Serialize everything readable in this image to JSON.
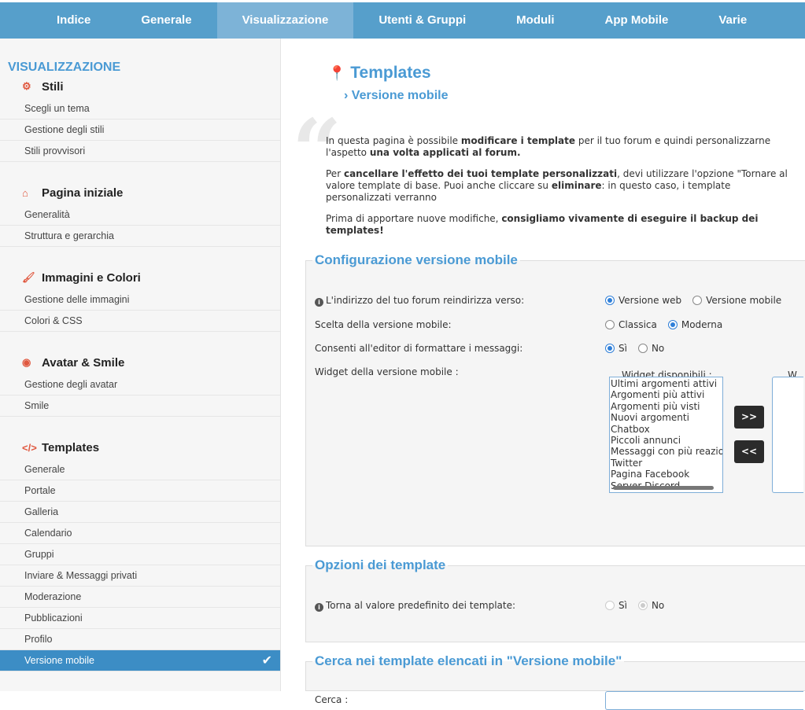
{
  "nav": [
    "Indice",
    "Generale",
    "Visualizzazione",
    "Utenti & Gruppi",
    "Moduli",
    "App Mobile",
    "Varie"
  ],
  "sidebar": {
    "heading": "VISUALIZZAZIONE",
    "sections": [
      {
        "title": "Stili",
        "icon": "gears-icon",
        "items": [
          "Scegli un tema",
          "Gestione degli stili",
          "Stili provvisori"
        ]
      },
      {
        "title": "Pagina iniziale",
        "icon": "home-icon",
        "items": [
          "Generalità",
          "Struttura e gerarchia"
        ]
      },
      {
        "title": "Immagini e Colori",
        "icon": "brush-icon",
        "items": [
          "Gestione delle immagini",
          "Colori & CSS"
        ]
      },
      {
        "title": "Avatar & Smile",
        "icon": "user-circle-icon",
        "items": [
          "Gestione degli avatar",
          "Smile"
        ]
      },
      {
        "title": "Templates",
        "icon": "code-icon",
        "items": [
          "Generale",
          "Portale",
          "Galleria",
          "Calendario",
          "Gruppi",
          "Inviare & Messaggi privati",
          "Moderazione",
          "Pubblicazioni",
          "Profilo",
          "Versione mobile"
        ]
      }
    ]
  },
  "main": {
    "title": "Templates",
    "subtitle": "Versione mobile",
    "intro": {
      "p1a": "In questa pagina è possibile ",
      "p1b": "modificare i template",
      "p1c": " per il tuo forum e quindi personalizzarne l'aspetto",
      "p1d": "una volta applicati al forum.",
      "p2a": "Per ",
      "p2b": "cancellare l'effetto dei tuoi template personalizzati",
      "p2c": ", devi utilizzare l'opzione \"Tornare al valore",
      "p2d": "template di base. Puoi anche cliccare su ",
      "p2e": "eliminare",
      "p2f": ": in questo caso, i template personalizzati verranno",
      "p3a": "Prima di apportare nuove modifiche, ",
      "p3b": "consigliamo vivamente di eseguire il backup dei templates!"
    },
    "config": {
      "legend": "Configurazione versione mobile",
      "redirect_label": "L'indirizzo del tuo forum reindirizza verso:",
      "redirect_opts": [
        "Versione web",
        "Versione mobile"
      ],
      "version_label": "Scelta della versione mobile:",
      "version_opts": [
        "Classica",
        "Moderna"
      ],
      "editor_label": "Consenti all'editor di formattare i messaggi:",
      "editor_opts": [
        "Sì",
        "No"
      ],
      "widget_label": "Widget della versione mobile :",
      "available_label": "Widget disponibili :",
      "selected_label": "W",
      "widgets": [
        "Ultimi argomenti attivi",
        "Argomenti più attivi",
        "Argomenti più visti",
        "Nuovi argomenti",
        "Chatbox",
        "Piccoli annunci",
        "Messaggi con più reazio",
        "Twitter",
        "Pagina Facebook",
        "Server Discord"
      ],
      "add_btn": ">>",
      "remove_btn": "<<"
    },
    "options": {
      "legend": "Opzioni dei template",
      "reset_label": "Torna al valore predefinito dei template:",
      "reset_opts": [
        "Sì",
        "No"
      ]
    },
    "search": {
      "legend": "Cerca nei template elencati in \"Versione mobile\"",
      "label": "Cerca :"
    }
  },
  "colors": {
    "nav": "#569fcb",
    "accent": "#4a9ad4",
    "icon": "#e0583f"
  }
}
